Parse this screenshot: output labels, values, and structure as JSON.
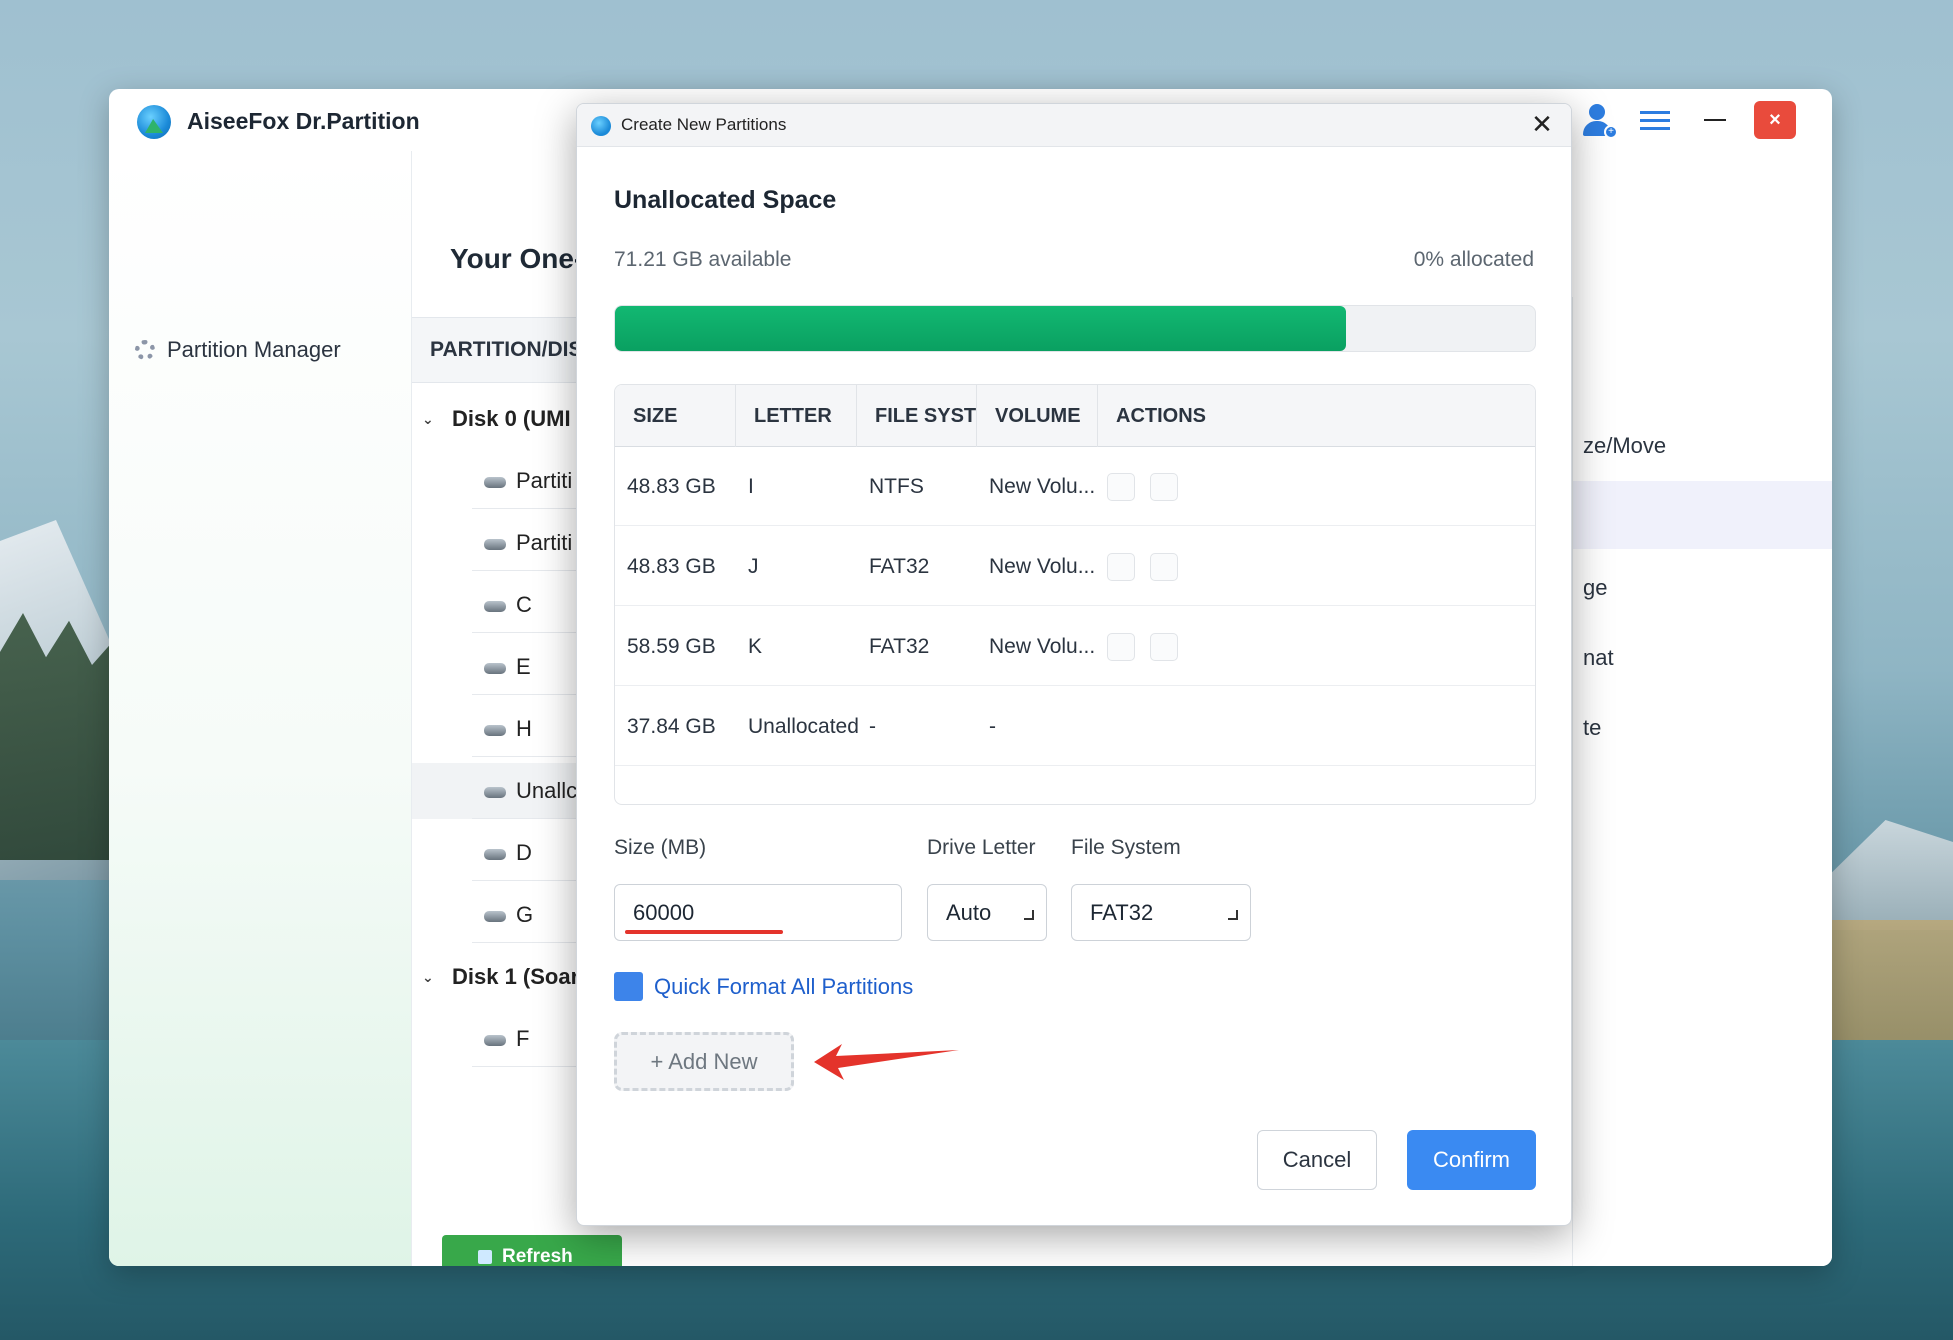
{
  "app": {
    "title": "AiseeFox Dr.Partition",
    "sidebar": {
      "items": [
        {
          "label": "Partition Manager",
          "icon": "gear-icon"
        }
      ]
    },
    "main": {
      "title": "Your One-",
      "column_header": "PARTITION/DIS",
      "tree": [
        {
          "type": "disk",
          "label": "Disk 0 (UMI"
        },
        {
          "type": "part",
          "label": "Partiti"
        },
        {
          "type": "part",
          "label": "Partiti"
        },
        {
          "type": "part",
          "label": "C"
        },
        {
          "type": "part",
          "label": "E"
        },
        {
          "type": "part",
          "label": "H"
        },
        {
          "type": "part",
          "label": "Unallc",
          "selected": true
        },
        {
          "type": "part",
          "label": "D"
        },
        {
          "type": "part",
          "label": "G"
        },
        {
          "type": "disk",
          "label": "Disk 1 (Soar"
        },
        {
          "type": "part",
          "label": "F"
        }
      ],
      "refresh_label": "Refresh"
    },
    "right_panel": {
      "items": [
        "ze/Move",
        "ge",
        "nat",
        "te"
      ]
    },
    "window_controls": {
      "minimize": "minimize",
      "close": "×"
    }
  },
  "dialog": {
    "title": "Create New Partitions",
    "close_glyph": "✕",
    "heading": "Unallocated Space",
    "available": "71.21 GB available",
    "allocated": "0% allocated",
    "progress_fraction": 0.795,
    "progress_color": "#0ea865",
    "table": {
      "headers": [
        "SIZE",
        "LETTER",
        "FILE SYSTEM",
        "VOLUME",
        "ACTIONS"
      ],
      "rows": [
        {
          "size": "48.83 GB",
          "letter": "I",
          "fs": "NTFS",
          "volume": "New Volu...",
          "actions": true
        },
        {
          "size": "48.83 GB",
          "letter": "J",
          "fs": "FAT32",
          "volume": "New Volu...",
          "actions": true
        },
        {
          "size": "58.59 GB",
          "letter": "K",
          "fs": "FAT32",
          "volume": "New Volu...",
          "actions": true
        },
        {
          "size": "37.84 GB",
          "letter": "Unallocated",
          "fs": "-",
          "volume": "-",
          "actions": false
        }
      ]
    },
    "form": {
      "size_label": "Size (MB)",
      "size_value": "60000",
      "letter_label": "Drive Letter",
      "letter_value": "Auto",
      "fs_label": "File System",
      "fs_value": "FAT32"
    },
    "quick_format_label": "Quick Format All Partitions",
    "add_new_label": "+ Add New",
    "cancel_label": "Cancel",
    "confirm_label": "Confirm",
    "accent_color": "#3a8af2"
  }
}
